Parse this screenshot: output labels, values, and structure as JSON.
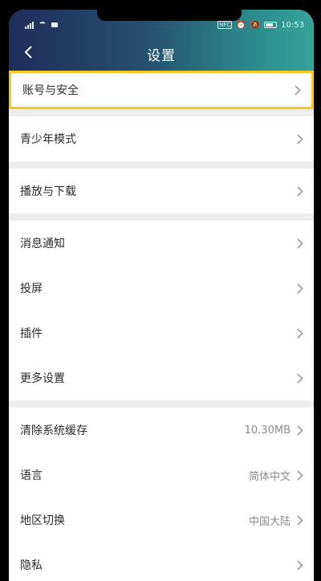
{
  "status_bar": {
    "time": "10:53",
    "icons": [
      "signal-icon",
      "wifi-icon",
      "sim-icon",
      "nfc-icon",
      "alarm-icon",
      "silent-icon",
      "battery-icon"
    ],
    "nfc_label": "NFC"
  },
  "header": {
    "title": "设置",
    "back_icon": "chevron-left-icon",
    "gradient_colors": [
      "#1e2d5a",
      "#35a39a"
    ]
  },
  "groups": [
    {
      "items": [
        {
          "label": "账号与安全",
          "value": "",
          "highlighted": true
        }
      ]
    },
    {
      "items": [
        {
          "label": "青少年模式",
          "value": ""
        }
      ]
    },
    {
      "items": [
        {
          "label": "播放与下载",
          "value": ""
        }
      ]
    },
    {
      "items": [
        {
          "label": "消息通知",
          "value": ""
        },
        {
          "label": "投屏",
          "value": ""
        },
        {
          "label": "插件",
          "value": ""
        },
        {
          "label": "更多设置",
          "value": ""
        }
      ]
    },
    {
      "items": [
        {
          "label": "清除系统缓存",
          "value": "10.30MB"
        },
        {
          "label": "语言",
          "value": "简体中文"
        },
        {
          "label": "地区切换",
          "value": "中国大陆"
        },
        {
          "label": "隐私",
          "value": ""
        }
      ]
    }
  ],
  "highlight_color": "#f6c623"
}
